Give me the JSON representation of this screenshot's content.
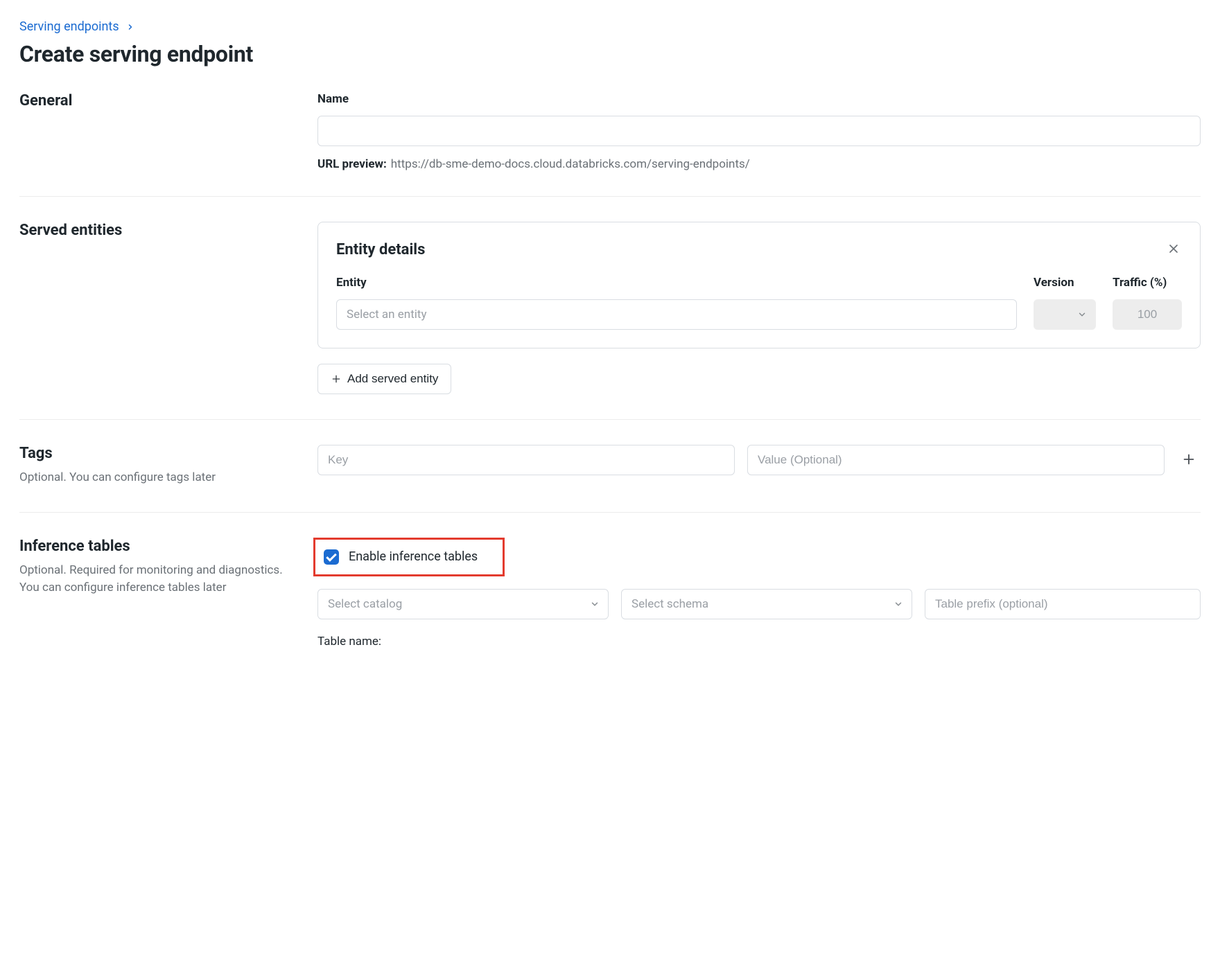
{
  "breadcrumb": {
    "parent": "Serving endpoints"
  },
  "page_title": "Create serving endpoint",
  "general": {
    "heading": "General",
    "name_label": "Name",
    "name_value": "",
    "url_preview_label": "URL preview:",
    "url_preview_value": "https://db-sme-demo-docs.cloud.databricks.com/serving-endpoints/"
  },
  "served_entities": {
    "heading": "Served entities",
    "card_title": "Entity details",
    "entity_label": "Entity",
    "entity_placeholder": "Select an entity",
    "version_label": "Version",
    "traffic_label": "Traffic (%)",
    "traffic_value": "100",
    "add_button": "Add served entity"
  },
  "tags": {
    "heading": "Tags",
    "subtext": "Optional. You can configure tags later",
    "key_placeholder": "Key",
    "value_placeholder": "Value (Optional)"
  },
  "inference": {
    "heading": "Inference tables",
    "subtext": "Optional. Required for monitoring and diagnostics. You can configure inference tables later",
    "enable_label": "Enable inference tables",
    "enabled": true,
    "catalog_placeholder": "Select catalog",
    "schema_placeholder": "Select schema",
    "prefix_placeholder": "Table prefix (optional)",
    "table_name_label": "Table name:"
  }
}
